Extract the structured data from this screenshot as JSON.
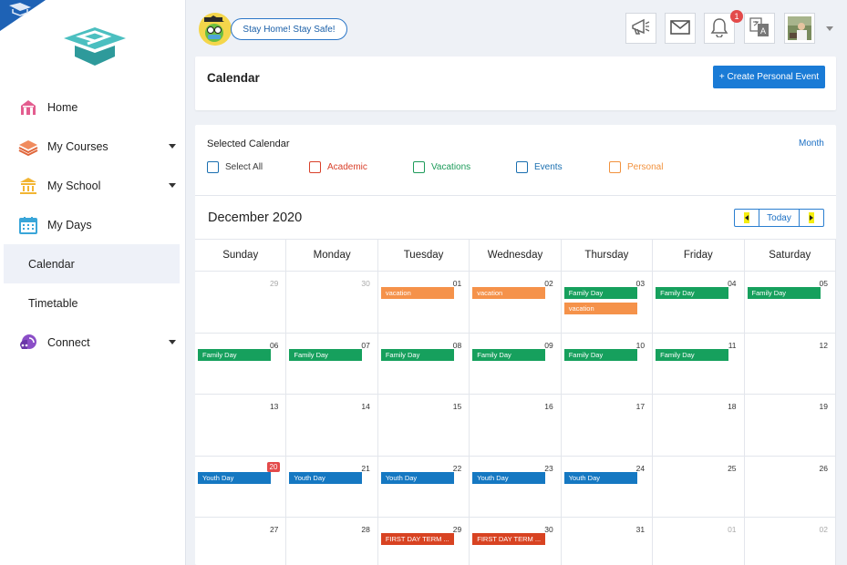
{
  "colors": {
    "accent": "#1a7bd6",
    "academic": "#d9412b",
    "vacations": "#1d9b5a",
    "events": "#1a6fb0",
    "personal": "#f2923e",
    "family_day": "#16a05d",
    "youth_day": "#1578c2",
    "term": "#d84322",
    "vacation": "#f5924a"
  },
  "sidebar": {
    "items": [
      {
        "label": "Home",
        "icon": "home-icon"
      },
      {
        "label": "My Courses",
        "icon": "books-icon"
      },
      {
        "label": "My School",
        "icon": "school-icon"
      },
      {
        "label": "My Days",
        "icon": "calendar-icon"
      },
      {
        "label": "Calendar"
      },
      {
        "label": "Timetable"
      },
      {
        "label": "Connect",
        "icon": "chat-icon"
      }
    ]
  },
  "topbar": {
    "stay_label": "Stay Home! Stay Safe!",
    "notification_count": "1",
    "icons": [
      "megaphone-icon",
      "mail-icon",
      "bell-icon",
      "translate-icon"
    ]
  },
  "header": {
    "title": "Calendar",
    "create_label": "+ Create Personal Event"
  },
  "calendar": {
    "selected_label": "Selected Calendar",
    "view_label": "Month",
    "filters": [
      {
        "label": "Select All",
        "color": "#3b3b3b"
      },
      {
        "label": "Academic",
        "color": "#d9412b"
      },
      {
        "label": "Vacations",
        "color": "#1d9b5a"
      },
      {
        "label": "Events",
        "color": "#1a6fb0"
      },
      {
        "label": "Personal",
        "color": "#f2923e"
      }
    ],
    "month_title": "December 2020",
    "today_label": "Today",
    "weekdays": [
      "Sunday",
      "Monday",
      "Tuesday",
      "Wednesday",
      "Thursday",
      "Friday",
      "Saturday"
    ],
    "weeks": [
      [
        {
          "n": "29",
          "out": true,
          "events": []
        },
        {
          "n": "30",
          "out": true,
          "events": []
        },
        {
          "n": "01",
          "events": [
            {
              "label": "vacation",
              "kind": "vacation"
            }
          ]
        },
        {
          "n": "02",
          "events": [
            {
              "label": "vacation",
              "kind": "vacation"
            }
          ]
        },
        {
          "n": "03",
          "events": [
            {
              "label": "Family Day",
              "kind": "family"
            },
            {
              "label": "vacation",
              "kind": "vacation"
            }
          ]
        },
        {
          "n": "04",
          "events": [
            {
              "label": "Family Day",
              "kind": "family"
            }
          ]
        },
        {
          "n": "05",
          "events": [
            {
              "label": "Family Day",
              "kind": "family"
            }
          ]
        }
      ],
      [
        {
          "n": "06",
          "events": [
            {
              "label": "Family Day",
              "kind": "family"
            }
          ]
        },
        {
          "n": "07",
          "events": [
            {
              "label": "Family Day",
              "kind": "family"
            }
          ]
        },
        {
          "n": "08",
          "events": [
            {
              "label": "Family Day",
              "kind": "family"
            }
          ]
        },
        {
          "n": "09",
          "events": [
            {
              "label": "Family Day",
              "kind": "family"
            }
          ]
        },
        {
          "n": "10",
          "events": [
            {
              "label": "Family Day",
              "kind": "family"
            }
          ]
        },
        {
          "n": "11",
          "events": [
            {
              "label": "Family Day",
              "kind": "family"
            }
          ]
        },
        {
          "n": "12",
          "events": []
        }
      ],
      [
        {
          "n": "13",
          "events": []
        },
        {
          "n": "14",
          "events": []
        },
        {
          "n": "15",
          "events": []
        },
        {
          "n": "16",
          "events": []
        },
        {
          "n": "17",
          "events": []
        },
        {
          "n": "18",
          "events": []
        },
        {
          "n": "19",
          "events": []
        }
      ],
      [
        {
          "n": "20",
          "today": true,
          "events": [
            {
              "label": "Youth Day",
              "kind": "youth"
            }
          ]
        },
        {
          "n": "21",
          "events": [
            {
              "label": "Youth Day",
              "kind": "youth"
            }
          ]
        },
        {
          "n": "22",
          "events": [
            {
              "label": "Youth Day",
              "kind": "youth"
            }
          ]
        },
        {
          "n": "23",
          "events": [
            {
              "label": "Youth Day",
              "kind": "youth"
            }
          ]
        },
        {
          "n": "24",
          "events": [
            {
              "label": "Youth Day",
              "kind": "youth"
            }
          ]
        },
        {
          "n": "25",
          "events": []
        },
        {
          "n": "26",
          "events": []
        }
      ],
      [
        {
          "n": "27",
          "events": []
        },
        {
          "n": "28",
          "events": []
        },
        {
          "n": "29",
          "events": [
            {
              "label": "FIRST DAY TERM ...",
              "kind": "term"
            }
          ]
        },
        {
          "n": "30",
          "events": [
            {
              "label": "FIRST DAY TERM ...",
              "kind": "term"
            }
          ]
        },
        {
          "n": "31",
          "events": []
        },
        {
          "n": "01",
          "out": true,
          "events": []
        },
        {
          "n": "02",
          "out": true,
          "events": []
        }
      ]
    ]
  }
}
